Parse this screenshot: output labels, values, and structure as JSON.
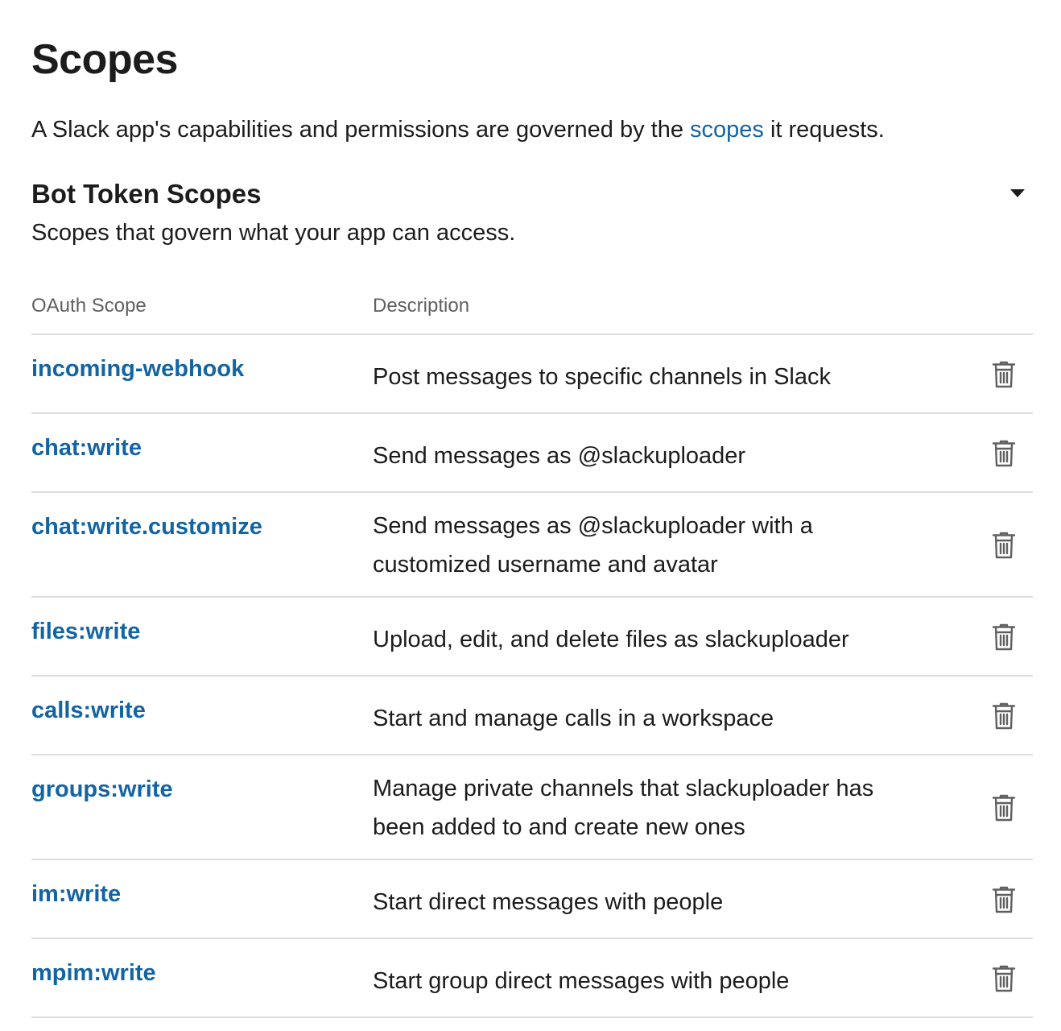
{
  "header": {
    "title": "Scopes",
    "intro_before": "A Slack app's capabilities and permissions are governed by the ",
    "intro_link": "scopes",
    "intro_after": " it requests."
  },
  "bot_token_scopes": {
    "title": "Bot Token Scopes",
    "subtitle": "Scopes that govern what your app can access.",
    "toggle_icon": "caret-down-icon",
    "columns": {
      "scope": "OAuth Scope",
      "description": "Description"
    },
    "rows": [
      {
        "scope": "incoming-webhook",
        "description": "Post messages to specific channels in Slack",
        "icon": "trash-icon"
      },
      {
        "scope": "chat:write",
        "description": "Send messages as @slackuploader",
        "icon": "trash-icon"
      },
      {
        "scope": "chat:write.customize",
        "description": "Send messages as @slackuploader with a customized username and avatar",
        "icon": "trash-icon"
      },
      {
        "scope": "files:write",
        "description": "Upload, edit, and delete files as slackuploader",
        "icon": "trash-icon"
      },
      {
        "scope": "calls:write",
        "description": "Start and manage calls in a workspace",
        "icon": "trash-icon"
      },
      {
        "scope": "groups:write",
        "description": "Manage private channels that slackuploader has been added to and create new ones",
        "icon": "trash-icon"
      },
      {
        "scope": "im:write",
        "description": "Start direct messages with people",
        "icon": "trash-icon"
      },
      {
        "scope": "mpim:write",
        "description": "Start group direct messages with people",
        "icon": "trash-icon"
      }
    ]
  },
  "colors": {
    "link": "#1264a3",
    "text": "#1d1c1d",
    "muted": "#616061",
    "divider": "#dddddd",
    "icon": "#616061"
  }
}
